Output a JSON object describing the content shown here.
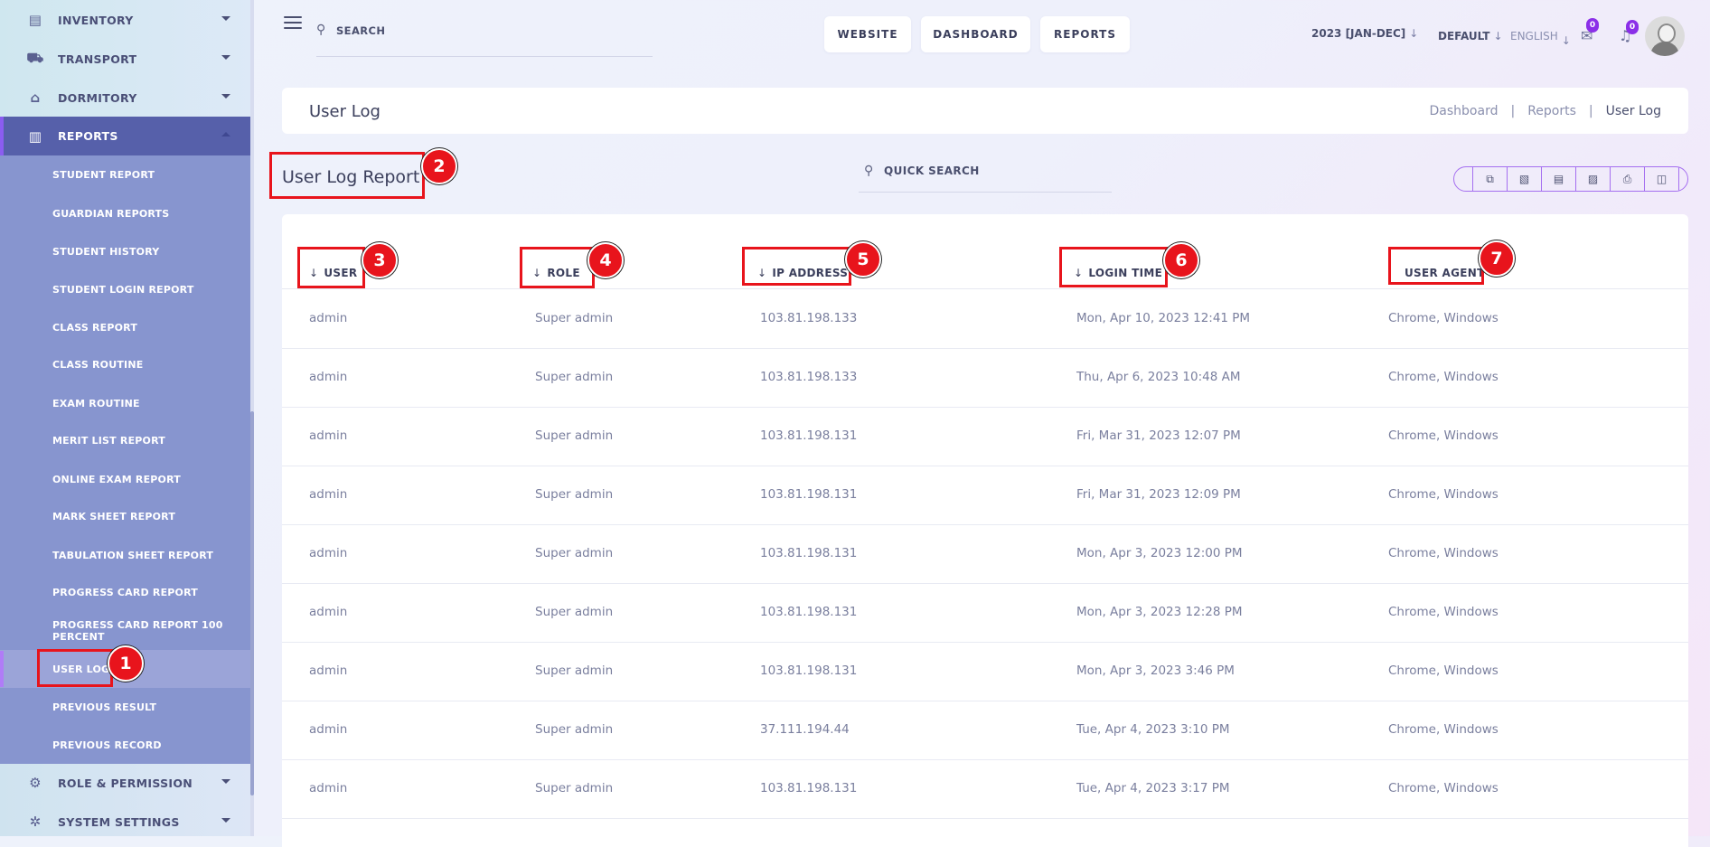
{
  "sidebar": {
    "menu": [
      {
        "label": "INVENTORY",
        "icon": "inventory-icon"
      },
      {
        "label": "TRANSPORT",
        "icon": "bus-icon"
      },
      {
        "label": "DORMITORY",
        "icon": "bed-icon"
      },
      {
        "label": "REPORTS",
        "icon": "report-icon"
      },
      {
        "label": "ROLE & PERMISSION",
        "icon": "role-icon"
      },
      {
        "label": "SYSTEM SETTINGS",
        "icon": "settings-icon"
      }
    ],
    "report_items": [
      "STUDENT REPORT",
      "GUARDIAN REPORTS",
      "STUDENT HISTORY",
      "STUDENT LOGIN REPORT",
      "CLASS REPORT",
      "CLASS ROUTINE",
      "EXAM ROUTINE",
      "MERIT LIST REPORT",
      "ONLINE EXAM REPORT",
      "MARK SHEET REPORT",
      "TABULATION SHEET REPORT",
      "PROGRESS CARD REPORT",
      "PROGRESS CARD REPORT 100 PERCENT",
      "USER LOG",
      "PREVIOUS RESULT",
      "PREVIOUS RECORD"
    ]
  },
  "topbar": {
    "search_placeholder": "SEARCH",
    "buttons": [
      "WEBSITE",
      "DASHBOARD",
      "REPORTS"
    ],
    "session": "2023 [JAN-DEC]",
    "style": "DEFAULT",
    "language": "ENGLISH",
    "message_count": "0",
    "notification_count": "0"
  },
  "breadcrumb": {
    "title": "User Log",
    "links": [
      "Dashboard",
      "Reports",
      "User Log"
    ]
  },
  "report": {
    "title": "User Log Report",
    "quick_search": "QUICK SEARCH",
    "tools": [
      "copy-icon",
      "excel-icon",
      "csv-icon",
      "pdf-icon",
      "print-icon",
      "columns-icon"
    ]
  },
  "table": {
    "headers": [
      "USER",
      "ROLE",
      "IP ADDRESS",
      "LOGIN TIME",
      "USER AGENT"
    ],
    "rows": [
      [
        "admin",
        "Super admin",
        "103.81.198.133",
        "Mon, Apr 10, 2023 12:41 PM",
        "Chrome, Windows"
      ],
      [
        "admin",
        "Super admin",
        "103.81.198.133",
        "Thu, Apr 6, 2023 10:48 AM",
        "Chrome, Windows"
      ],
      [
        "admin",
        "Super admin",
        "103.81.198.131",
        "Fri, Mar 31, 2023 12:07 PM",
        "Chrome, Windows"
      ],
      [
        "admin",
        "Super admin",
        "103.81.198.131",
        "Fri, Mar 31, 2023 12:09 PM",
        "Chrome, Windows"
      ],
      [
        "admin",
        "Super admin",
        "103.81.198.131",
        "Mon, Apr 3, 2023 12:00 PM",
        "Chrome, Windows"
      ],
      [
        "admin",
        "Super admin",
        "103.81.198.131",
        "Mon, Apr 3, 2023 12:28 PM",
        "Chrome, Windows"
      ],
      [
        "admin",
        "Super admin",
        "103.81.198.131",
        "Mon, Apr 3, 2023 3:46 PM",
        "Chrome, Windows"
      ],
      [
        "admin",
        "Super admin",
        "37.111.194.44",
        "Tue, Apr 4, 2023 3:10 PM",
        "Chrome, Windows"
      ],
      [
        "admin",
        "Super admin",
        "103.81.198.131",
        "Tue, Apr 4, 2023 3:17 PM",
        "Chrome, Windows"
      ]
    ]
  },
  "annotations": [
    "1",
    "2",
    "3",
    "4",
    "5",
    "6",
    "7"
  ],
  "colors": {
    "sidebar_bg": "#8795cf",
    "active_menu": "#5660aa",
    "annotation_red": "#e8141c",
    "badge_purple": "#8b2fe8"
  }
}
